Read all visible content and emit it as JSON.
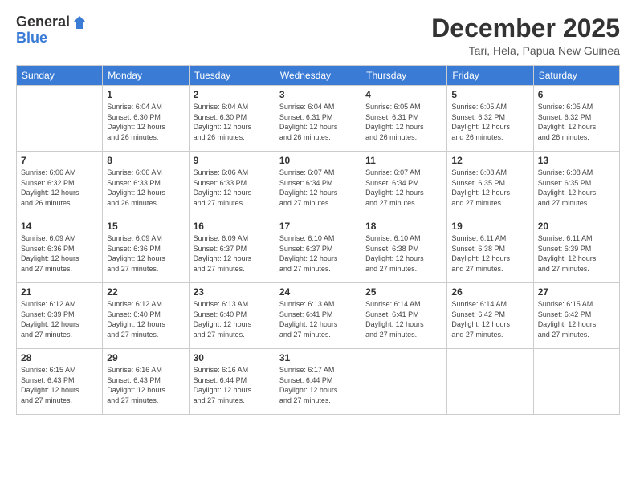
{
  "logo": {
    "general": "General",
    "blue": "Blue"
  },
  "title": "December 2025",
  "subtitle": "Tari, Hela, Papua New Guinea",
  "days_header": [
    "Sunday",
    "Monday",
    "Tuesday",
    "Wednesday",
    "Thursday",
    "Friday",
    "Saturday"
  ],
  "weeks": [
    [
      {
        "day": "",
        "info": ""
      },
      {
        "day": "1",
        "info": "Sunrise: 6:04 AM\nSunset: 6:30 PM\nDaylight: 12 hours\nand 26 minutes."
      },
      {
        "day": "2",
        "info": "Sunrise: 6:04 AM\nSunset: 6:30 PM\nDaylight: 12 hours\nand 26 minutes."
      },
      {
        "day": "3",
        "info": "Sunrise: 6:04 AM\nSunset: 6:31 PM\nDaylight: 12 hours\nand 26 minutes."
      },
      {
        "day": "4",
        "info": "Sunrise: 6:05 AM\nSunset: 6:31 PM\nDaylight: 12 hours\nand 26 minutes."
      },
      {
        "day": "5",
        "info": "Sunrise: 6:05 AM\nSunset: 6:32 PM\nDaylight: 12 hours\nand 26 minutes."
      },
      {
        "day": "6",
        "info": "Sunrise: 6:05 AM\nSunset: 6:32 PM\nDaylight: 12 hours\nand 26 minutes."
      }
    ],
    [
      {
        "day": "7",
        "info": "Sunrise: 6:06 AM\nSunset: 6:32 PM\nDaylight: 12 hours\nand 26 minutes."
      },
      {
        "day": "8",
        "info": "Sunrise: 6:06 AM\nSunset: 6:33 PM\nDaylight: 12 hours\nand 26 minutes."
      },
      {
        "day": "9",
        "info": "Sunrise: 6:06 AM\nSunset: 6:33 PM\nDaylight: 12 hours\nand 27 minutes."
      },
      {
        "day": "10",
        "info": "Sunrise: 6:07 AM\nSunset: 6:34 PM\nDaylight: 12 hours\nand 27 minutes."
      },
      {
        "day": "11",
        "info": "Sunrise: 6:07 AM\nSunset: 6:34 PM\nDaylight: 12 hours\nand 27 minutes."
      },
      {
        "day": "12",
        "info": "Sunrise: 6:08 AM\nSunset: 6:35 PM\nDaylight: 12 hours\nand 27 minutes."
      },
      {
        "day": "13",
        "info": "Sunrise: 6:08 AM\nSunset: 6:35 PM\nDaylight: 12 hours\nand 27 minutes."
      }
    ],
    [
      {
        "day": "14",
        "info": "Sunrise: 6:09 AM\nSunset: 6:36 PM\nDaylight: 12 hours\nand 27 minutes."
      },
      {
        "day": "15",
        "info": "Sunrise: 6:09 AM\nSunset: 6:36 PM\nDaylight: 12 hours\nand 27 minutes."
      },
      {
        "day": "16",
        "info": "Sunrise: 6:09 AM\nSunset: 6:37 PM\nDaylight: 12 hours\nand 27 minutes."
      },
      {
        "day": "17",
        "info": "Sunrise: 6:10 AM\nSunset: 6:37 PM\nDaylight: 12 hours\nand 27 minutes."
      },
      {
        "day": "18",
        "info": "Sunrise: 6:10 AM\nSunset: 6:38 PM\nDaylight: 12 hours\nand 27 minutes."
      },
      {
        "day": "19",
        "info": "Sunrise: 6:11 AM\nSunset: 6:38 PM\nDaylight: 12 hours\nand 27 minutes."
      },
      {
        "day": "20",
        "info": "Sunrise: 6:11 AM\nSunset: 6:39 PM\nDaylight: 12 hours\nand 27 minutes."
      }
    ],
    [
      {
        "day": "21",
        "info": "Sunrise: 6:12 AM\nSunset: 6:39 PM\nDaylight: 12 hours\nand 27 minutes."
      },
      {
        "day": "22",
        "info": "Sunrise: 6:12 AM\nSunset: 6:40 PM\nDaylight: 12 hours\nand 27 minutes."
      },
      {
        "day": "23",
        "info": "Sunrise: 6:13 AM\nSunset: 6:40 PM\nDaylight: 12 hours\nand 27 minutes."
      },
      {
        "day": "24",
        "info": "Sunrise: 6:13 AM\nSunset: 6:41 PM\nDaylight: 12 hours\nand 27 minutes."
      },
      {
        "day": "25",
        "info": "Sunrise: 6:14 AM\nSunset: 6:41 PM\nDaylight: 12 hours\nand 27 minutes."
      },
      {
        "day": "26",
        "info": "Sunrise: 6:14 AM\nSunset: 6:42 PM\nDaylight: 12 hours\nand 27 minutes."
      },
      {
        "day": "27",
        "info": "Sunrise: 6:15 AM\nSunset: 6:42 PM\nDaylight: 12 hours\nand 27 minutes."
      }
    ],
    [
      {
        "day": "28",
        "info": "Sunrise: 6:15 AM\nSunset: 6:43 PM\nDaylight: 12 hours\nand 27 minutes."
      },
      {
        "day": "29",
        "info": "Sunrise: 6:16 AM\nSunset: 6:43 PM\nDaylight: 12 hours\nand 27 minutes."
      },
      {
        "day": "30",
        "info": "Sunrise: 6:16 AM\nSunset: 6:44 PM\nDaylight: 12 hours\nand 27 minutes."
      },
      {
        "day": "31",
        "info": "Sunrise: 6:17 AM\nSunset: 6:44 PM\nDaylight: 12 hours\nand 27 minutes."
      },
      {
        "day": "",
        "info": ""
      },
      {
        "day": "",
        "info": ""
      },
      {
        "day": "",
        "info": ""
      }
    ]
  ]
}
